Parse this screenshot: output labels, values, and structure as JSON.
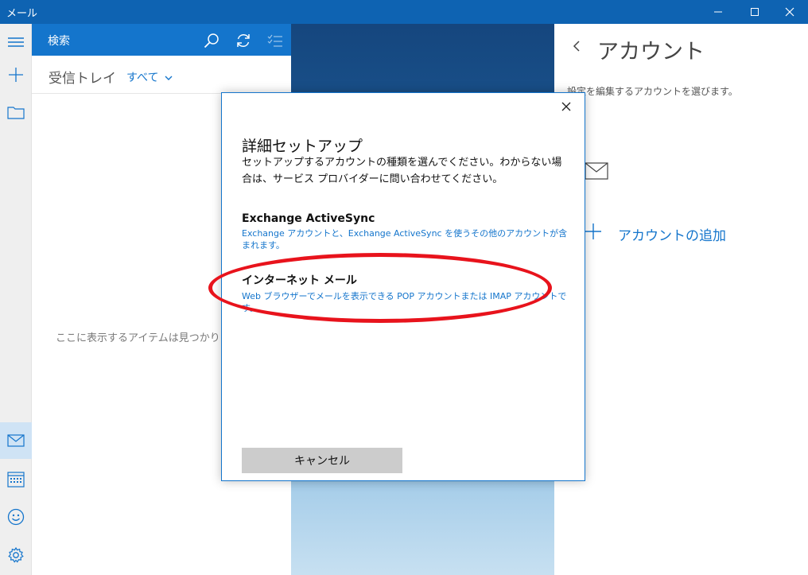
{
  "window": {
    "title": "メール"
  },
  "searchbar": {
    "label": "検索"
  },
  "msglist": {
    "folder": "受信トレイ",
    "filter": "すべて",
    "empty_text": "ここに表示するアイテムは見つかりませ"
  },
  "account": {
    "heading": "アカウント",
    "hint": "設定を編集するアカウントを選びます。",
    "add_label": "アカウントの追加"
  },
  "dialog": {
    "title": "詳細セットアップ",
    "description": "セットアップするアカウントの種類を選んでください。わからない場合は、サービス プロバイダーに問い合わせてください。",
    "options": [
      {
        "name": "Exchange ActiveSync",
        "description": "Exchange アカウントと、Exchange ActiveSync を使うその他のアカウントが含まれます。"
      },
      {
        "name": "インターネット メール",
        "description": "Web ブラウザーでメールを表示できる POP アカウントまたは IMAP アカウントです。"
      }
    ],
    "cancel_label": "キャンセル"
  },
  "colors": {
    "accent": "#1475cc",
    "titlebar": "#0e63b2",
    "highlight": "#e8131c"
  },
  "icons": [
    "minimize-icon",
    "maximize-icon",
    "close-icon",
    "hamburger-icon",
    "plus-icon",
    "folder-icon",
    "search-icon",
    "sync-icon",
    "select-icon",
    "chevron-down-icon",
    "back-icon",
    "mail-icon",
    "calendar-icon",
    "smiley-icon",
    "gear-icon",
    "add-icon"
  ]
}
